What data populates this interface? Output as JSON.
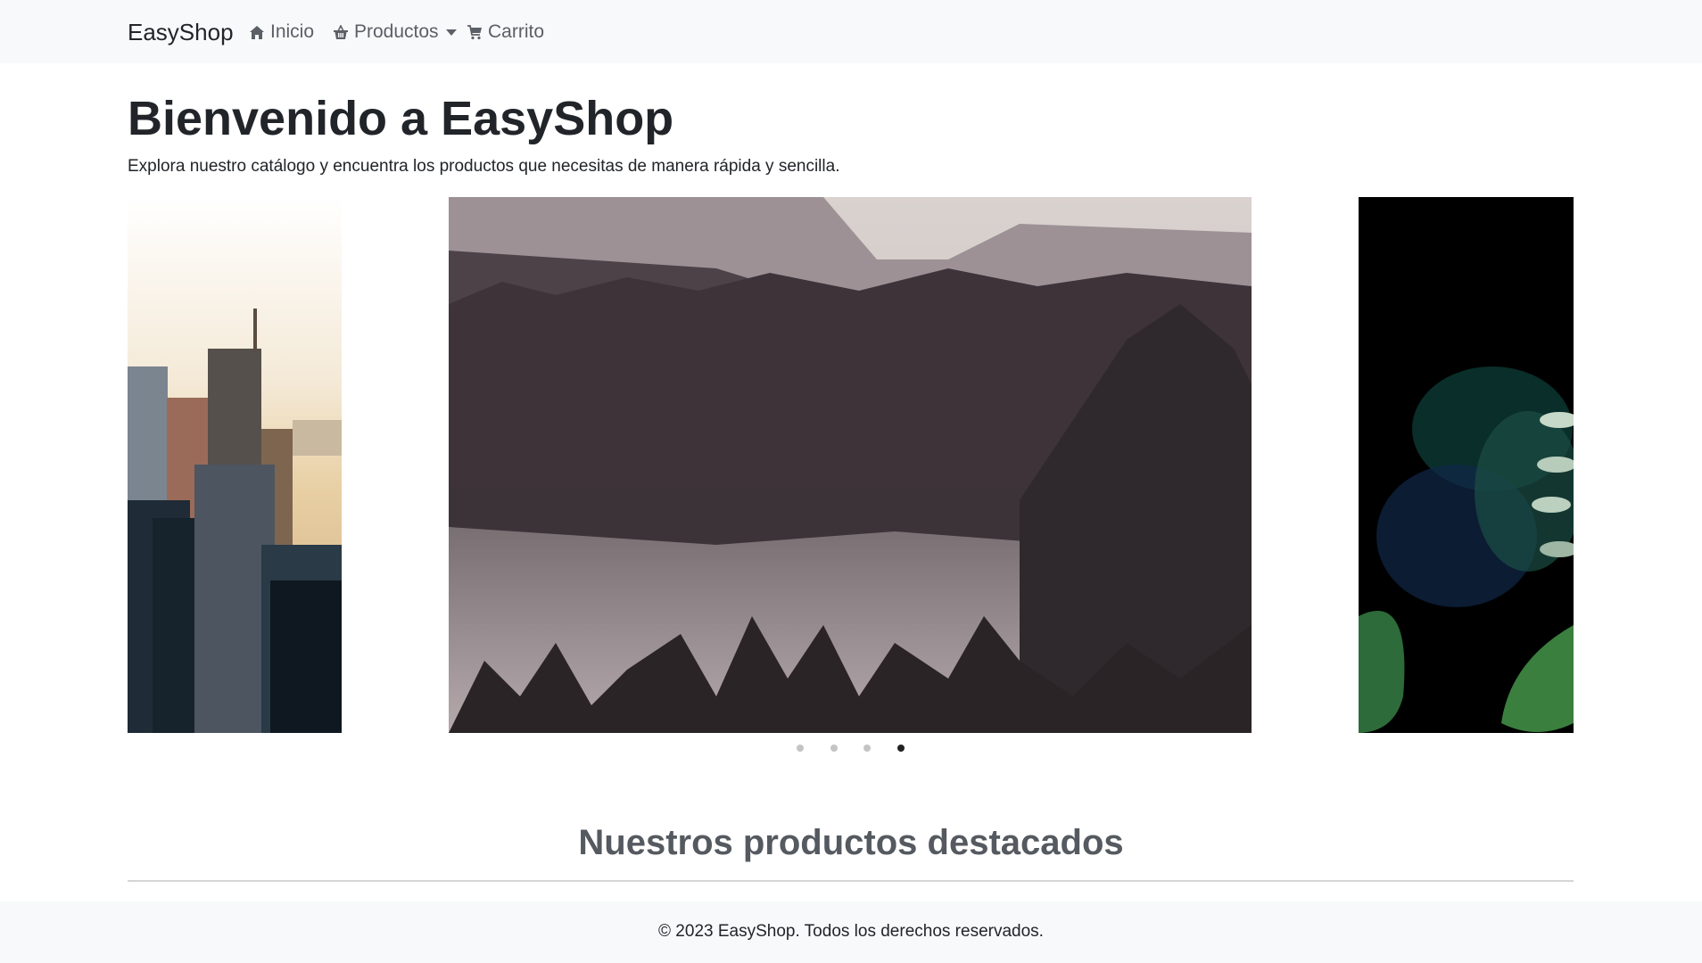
{
  "navbar": {
    "brand": "EasyShop",
    "items": [
      {
        "label": "Inicio",
        "icon": "home-icon"
      },
      {
        "label": "Productos",
        "icon": "basket-icon",
        "dropdown": true
      },
      {
        "label": "Carrito",
        "icon": "cart-icon"
      }
    ]
  },
  "hero": {
    "title": "Bienvenido a EasyShop",
    "subtitle": "Explora nuestro catálogo y encuentra los productos que necesitas de manera rápida y sencilla."
  },
  "carousel": {
    "slide_count": 4,
    "active_index": 3,
    "slides": [
      "city skyline",
      "forest lake",
      "green plant"
    ]
  },
  "featured": {
    "title": "Nuestros productos destacados"
  },
  "footer": {
    "text": "© 2023 EasyShop. Todos los derechos reservados."
  },
  "colors": {
    "navbar_bg": "#f8f9fa",
    "text": "#212529",
    "nav_link": "#5b6066",
    "dot_inactive": "#c4c4c4",
    "dot_active": "#222222"
  }
}
